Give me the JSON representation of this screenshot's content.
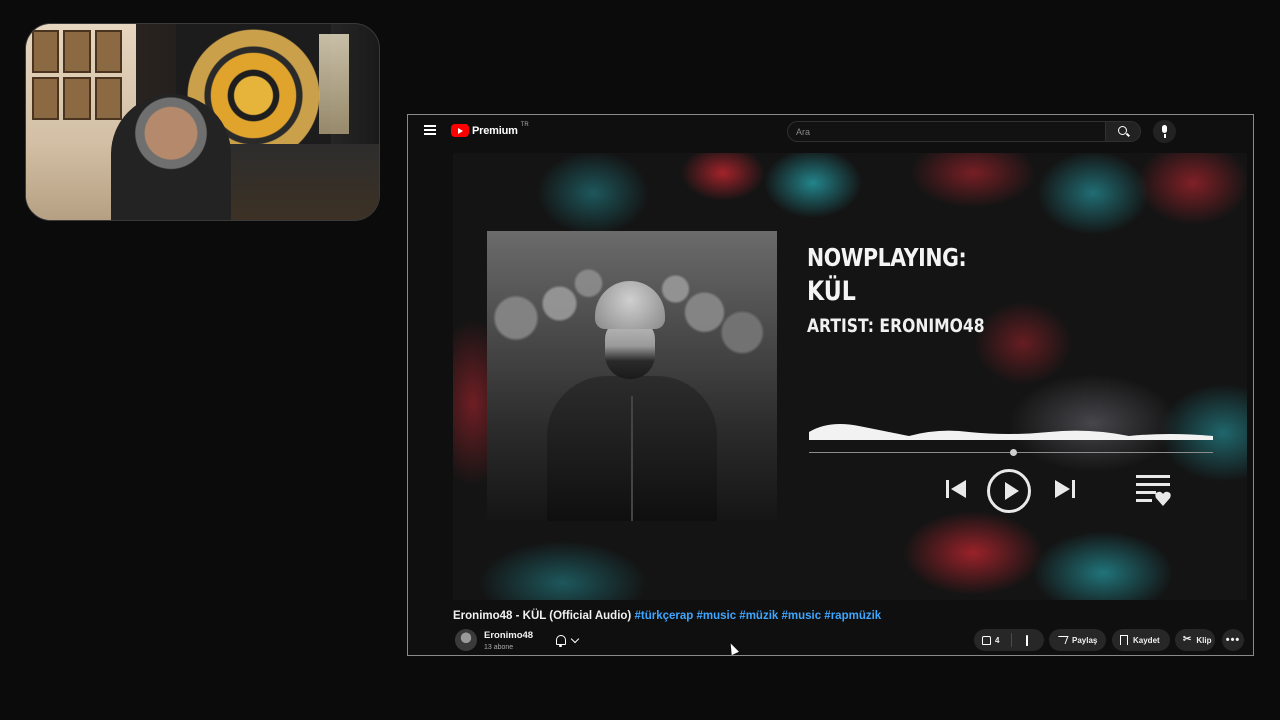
{
  "youtube": {
    "logo": {
      "name": "Premium",
      "region": "TR",
      "icon": "youtube-logo-icon"
    },
    "search": {
      "placeholder": "Ara",
      "value": ""
    },
    "icons": {
      "menu": "hamburger-menu-icon",
      "search": "search-icon",
      "mic": "microphone-icon"
    }
  },
  "video": {
    "now_playing_label": "NOWPLAYING:",
    "song": "KÜL",
    "artist_line": "ARTIST: ERONIMO48",
    "progress": 0.5
  },
  "details": {
    "title": "Eronimo48 - KÜL (Official Audio)",
    "hashtags": "#türkçerap #music #müzik #music #rapmüzik",
    "channel": {
      "name": "Eronimo48",
      "subscribers": "13 abone"
    },
    "likes": "4",
    "share_label": "Paylaş",
    "save_label": "Kaydet",
    "clip_label": "Klip",
    "more_label": "•••"
  },
  "colors": {
    "accent": "#ff0000",
    "link": "#3ea6ff",
    "background": "#0f0f0f"
  }
}
